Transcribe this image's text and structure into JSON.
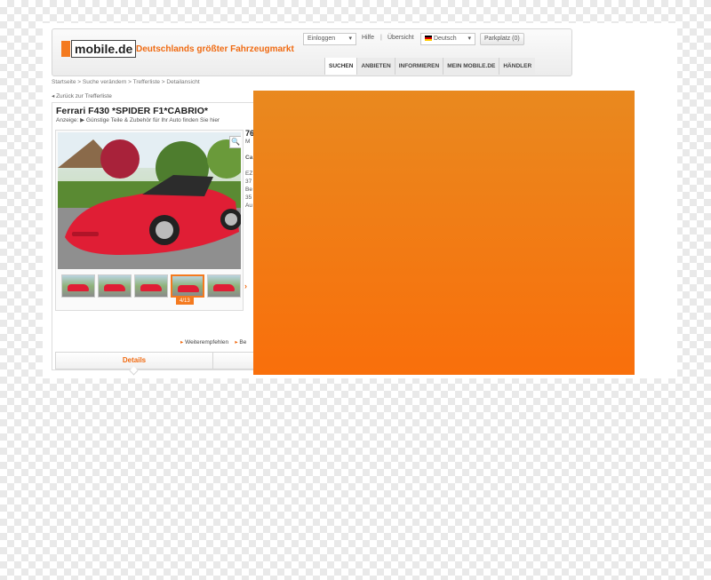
{
  "header": {
    "logo_text": "mobile.de",
    "tagline": "Deutschlands größter Fahrzeugmarkt",
    "login_label": "Einloggen",
    "help_label": "Hilfe",
    "overview_label": "Übersicht",
    "language_label": "Deutsch",
    "parking_label": "Parkplatz (0)",
    "brand_color": "#f47a1f"
  },
  "nav": {
    "tabs": [
      "SUCHEN",
      "ANBIETEN",
      "INFORMIEREN",
      "MEIN MOBILE.DE",
      "HÄNDLER"
    ]
  },
  "breadcrumb": "Startseite > Suche verändern > Trefferliste > Detailansicht",
  "back_link": "Zurück zur Trefferliste",
  "listing": {
    "title": "Ferrari F430 *SPIDER F1*CABRIO*",
    "ad_text": "Anzeige: ▶ Günstige Teile & Zubehör für Ihr Auto finden Sie hier",
    "photo_counter": "4/13",
    "info_lines": [
      "76",
      "M",
      "",
      "Ca",
      "",
      "EZ",
      "37",
      "Be",
      "35",
      "Au"
    ],
    "recommend_label": "Weiterempfehlen",
    "second_link_label": "Be",
    "details_tab_label": "Details"
  },
  "overlay_color": "#f47a1f"
}
